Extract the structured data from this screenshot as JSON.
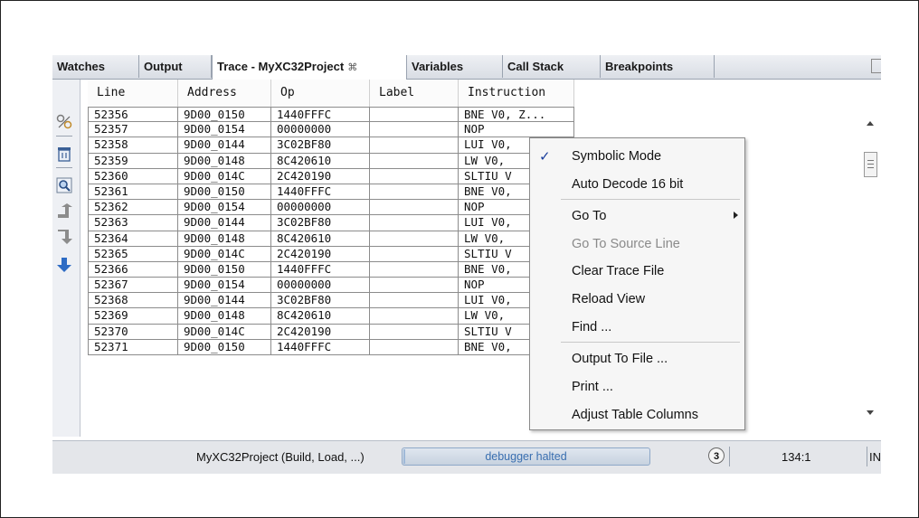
{
  "tabs": [
    {
      "label": "Watches",
      "active": false
    },
    {
      "label": "Output",
      "active": false
    },
    {
      "label": "Trace - MyXC32Project",
      "active": true,
      "close_glyph": "⌘"
    },
    {
      "label": "Variables",
      "active": false
    },
    {
      "label": "Call Stack",
      "active": false
    },
    {
      "label": "Breakpoints",
      "active": false
    }
  ],
  "toolbar_icons": [
    "symbol-mode-icon",
    "clear-trace-icon",
    "find-icon",
    "step-up-icon",
    "step-down-icon",
    "go-to-end-icon"
  ],
  "table": {
    "columns": [
      "Line",
      "Address",
      "Op",
      "Label",
      "Instruction"
    ],
    "rows": [
      [
        "52356",
        "9D00_0150",
        "1440FFFC",
        "",
        "BNE V0, Z..."
      ],
      [
        "52357",
        "9D00_0154",
        "00000000",
        "",
        "NOP"
      ],
      [
        "52358",
        "9D00_0144",
        "3C02BF80",
        "",
        "LUI V0,"
      ],
      [
        "52359",
        "9D00_0148",
        "8C420610",
        "",
        "LW V0,"
      ],
      [
        "52360",
        "9D00_014C",
        "2C420190",
        "",
        "SLTIU V"
      ],
      [
        "52361",
        "9D00_0150",
        "1440FFFC",
        "",
        "BNE V0,"
      ],
      [
        "52362",
        "9D00_0154",
        "00000000",
        "",
        "NOP"
      ],
      [
        "52363",
        "9D00_0144",
        "3C02BF80",
        "",
        "LUI V0,"
      ],
      [
        "52364",
        "9D00_0148",
        "8C420610",
        "",
        "LW V0,"
      ],
      [
        "52365",
        "9D00_014C",
        "2C420190",
        "",
        "SLTIU V"
      ],
      [
        "52366",
        "9D00_0150",
        "1440FFFC",
        "",
        "BNE V0,"
      ],
      [
        "52367",
        "9D00_0154",
        "00000000",
        "",
        "NOP"
      ],
      [
        "52368",
        "9D00_0144",
        "3C02BF80",
        "",
        "LUI V0,"
      ],
      [
        "52369",
        "9D00_0148",
        "8C420610",
        "",
        "LW V0,"
      ],
      [
        "52370",
        "9D00_014C",
        "2C420190",
        "",
        "SLTIU V"
      ],
      [
        "52371",
        "9D00_0150",
        "1440FFFC",
        "",
        "BNE V0,"
      ]
    ]
  },
  "context_menu": {
    "items": [
      {
        "label": "Symbolic Mode",
        "checked": true,
        "disabled": false
      },
      {
        "label": "Auto Decode 16 bit",
        "checked": false,
        "disabled": false
      },
      {
        "label": "Go To",
        "checked": false,
        "disabled": false,
        "submenu": true
      },
      {
        "label": "Go To Source Line",
        "checked": false,
        "disabled": true
      },
      {
        "label": "Clear Trace File",
        "checked": false,
        "disabled": false
      },
      {
        "label": "Reload View",
        "checked": false,
        "disabled": false
      },
      {
        "label": "Find ...",
        "checked": false,
        "disabled": false
      },
      {
        "label": "Output To File ...",
        "checked": false,
        "disabled": false
      },
      {
        "label": "Print ...",
        "checked": false,
        "disabled": false
      },
      {
        "label": "Adjust Table Columns",
        "checked": false,
        "disabled": false
      }
    ],
    "check_glyph": "✓"
  },
  "status_bar": {
    "project_text": "MyXC32Project (Build, Load, ...)",
    "progress_label": "debugger halted",
    "notification_count": "3",
    "cursor_position": "134:1",
    "mode": "INS"
  },
  "colors": {
    "progress_text": "#3a6fb0",
    "check": "#1a3e9c",
    "icon_blue": "#2d6bc4"
  }
}
